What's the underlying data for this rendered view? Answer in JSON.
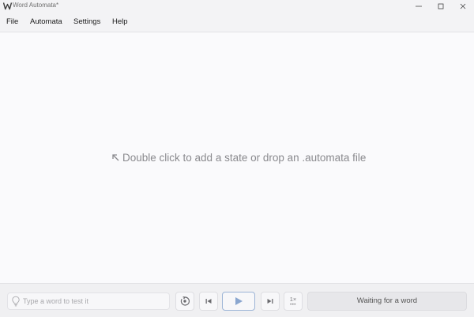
{
  "window": {
    "title": "Word Automata*",
    "app_icon": "automata-logo-icon",
    "controls": [
      "minimize-icon",
      "maximize-icon",
      "close-icon"
    ]
  },
  "menu": {
    "file": "File",
    "automata": "Automata",
    "settings": "Settings",
    "help": "Help"
  },
  "canvas": {
    "hint_icon": "arrow-up-left-icon",
    "hint": "Double click to add a state or drop an .automata file"
  },
  "bottom": {
    "input_icon": "lightbulb-icon",
    "input_placeholder": "Type a word to test it",
    "input_value": "",
    "reset_icon": "reset-icon",
    "prev_icon": "skip-back-icon",
    "play_icon": "play-icon",
    "next_icon": "skip-forward-icon",
    "speed_label": "1×",
    "status": "Waiting for a word"
  },
  "colors": {
    "window_bg": "#f3f3f5",
    "canvas_bg": "#fafafc",
    "accent": "#9cb4d6",
    "play_icon": "#8aa6cf",
    "hint_text": "#8a8a8e"
  }
}
